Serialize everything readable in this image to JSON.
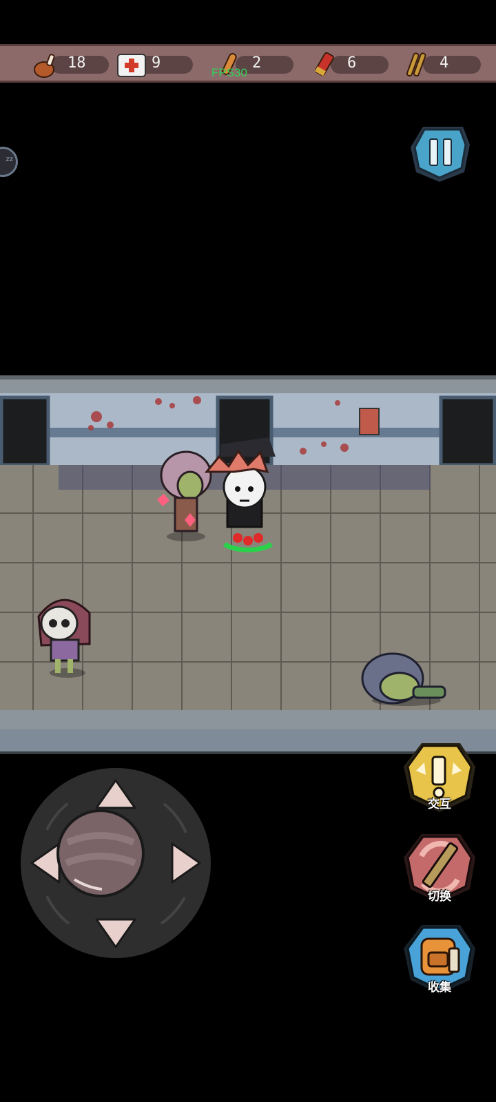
{
  "resources": [
    {
      "icon": "meat-drumstick-icon",
      "count": "18"
    },
    {
      "icon": "medkit-icon",
      "count": "9"
    },
    {
      "icon": "bullet-icon",
      "count": "2"
    },
    {
      "icon": "shotgun-shell-icon",
      "count": "6"
    },
    {
      "icon": "rifle-ammo-icon",
      "count": "4"
    }
  ],
  "fps": "FPS30",
  "side_tab": "zz",
  "buttons": {
    "interact": "交互",
    "switch": "切换",
    "collect": "收集"
  },
  "colors": {
    "resource_bar": "#8c6a6a",
    "fps_text": "#2fd35a",
    "pause_button": "#4aa3c8",
    "interact_button": "#e8c44a",
    "switch_button": "#c46a6a",
    "collect_button": "#4aa3d8"
  }
}
